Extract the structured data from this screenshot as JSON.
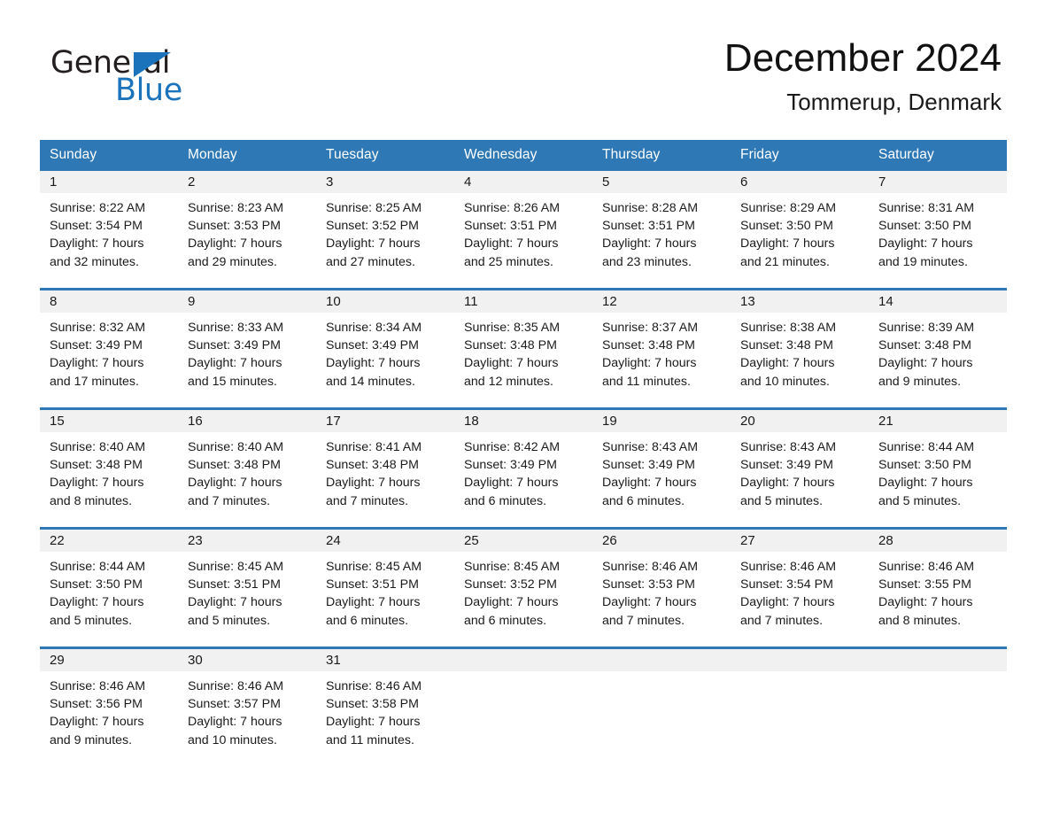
{
  "brand": {
    "name_part1": "General",
    "name_part2": "Blue",
    "triangle_color": "#1b74bb",
    "text_color": "#231f20"
  },
  "header": {
    "title": "December 2024",
    "subtitle": "Tommerup, Denmark"
  },
  "theme": {
    "accent": "#2e79b5",
    "header_text": "#ffffff",
    "daynum_band": "#f1f1f1",
    "body_text": "#1b1b1b"
  },
  "calendar": {
    "weekday_headers": [
      "Sunday",
      "Monday",
      "Tuesday",
      "Wednesday",
      "Thursday",
      "Friday",
      "Saturday"
    ],
    "weeks": [
      [
        {
          "day": "1",
          "details": "Sunrise: 8:22 AM\nSunset: 3:54 PM\nDaylight: 7 hours\nand 32 minutes."
        },
        {
          "day": "2",
          "details": "Sunrise: 8:23 AM\nSunset: 3:53 PM\nDaylight: 7 hours\nand 29 minutes."
        },
        {
          "day": "3",
          "details": "Sunrise: 8:25 AM\nSunset: 3:52 PM\nDaylight: 7 hours\nand 27 minutes."
        },
        {
          "day": "4",
          "details": "Sunrise: 8:26 AM\nSunset: 3:51 PM\nDaylight: 7 hours\nand 25 minutes."
        },
        {
          "day": "5",
          "details": "Sunrise: 8:28 AM\nSunset: 3:51 PM\nDaylight: 7 hours\nand 23 minutes."
        },
        {
          "day": "6",
          "details": "Sunrise: 8:29 AM\nSunset: 3:50 PM\nDaylight: 7 hours\nand 21 minutes."
        },
        {
          "day": "7",
          "details": "Sunrise: 8:31 AM\nSunset: 3:50 PM\nDaylight: 7 hours\nand 19 minutes."
        }
      ],
      [
        {
          "day": "8",
          "details": "Sunrise: 8:32 AM\nSunset: 3:49 PM\nDaylight: 7 hours\nand 17 minutes."
        },
        {
          "day": "9",
          "details": "Sunrise: 8:33 AM\nSunset: 3:49 PM\nDaylight: 7 hours\nand 15 minutes."
        },
        {
          "day": "10",
          "details": "Sunrise: 8:34 AM\nSunset: 3:49 PM\nDaylight: 7 hours\nand 14 minutes."
        },
        {
          "day": "11",
          "details": "Sunrise: 8:35 AM\nSunset: 3:48 PM\nDaylight: 7 hours\nand 12 minutes."
        },
        {
          "day": "12",
          "details": "Sunrise: 8:37 AM\nSunset: 3:48 PM\nDaylight: 7 hours\nand 11 minutes."
        },
        {
          "day": "13",
          "details": "Sunrise: 8:38 AM\nSunset: 3:48 PM\nDaylight: 7 hours\nand 10 minutes."
        },
        {
          "day": "14",
          "details": "Sunrise: 8:39 AM\nSunset: 3:48 PM\nDaylight: 7 hours\nand 9 minutes."
        }
      ],
      [
        {
          "day": "15",
          "details": "Sunrise: 8:40 AM\nSunset: 3:48 PM\nDaylight: 7 hours\nand 8 minutes."
        },
        {
          "day": "16",
          "details": "Sunrise: 8:40 AM\nSunset: 3:48 PM\nDaylight: 7 hours\nand 7 minutes."
        },
        {
          "day": "17",
          "details": "Sunrise: 8:41 AM\nSunset: 3:48 PM\nDaylight: 7 hours\nand 7 minutes."
        },
        {
          "day": "18",
          "details": "Sunrise: 8:42 AM\nSunset: 3:49 PM\nDaylight: 7 hours\nand 6 minutes."
        },
        {
          "day": "19",
          "details": "Sunrise: 8:43 AM\nSunset: 3:49 PM\nDaylight: 7 hours\nand 6 minutes."
        },
        {
          "day": "20",
          "details": "Sunrise: 8:43 AM\nSunset: 3:49 PM\nDaylight: 7 hours\nand 5 minutes."
        },
        {
          "day": "21",
          "details": "Sunrise: 8:44 AM\nSunset: 3:50 PM\nDaylight: 7 hours\nand 5 minutes."
        }
      ],
      [
        {
          "day": "22",
          "details": "Sunrise: 8:44 AM\nSunset: 3:50 PM\nDaylight: 7 hours\nand 5 minutes."
        },
        {
          "day": "23",
          "details": "Sunrise: 8:45 AM\nSunset: 3:51 PM\nDaylight: 7 hours\nand 5 minutes."
        },
        {
          "day": "24",
          "details": "Sunrise: 8:45 AM\nSunset: 3:51 PM\nDaylight: 7 hours\nand 6 minutes."
        },
        {
          "day": "25",
          "details": "Sunrise: 8:45 AM\nSunset: 3:52 PM\nDaylight: 7 hours\nand 6 minutes."
        },
        {
          "day": "26",
          "details": "Sunrise: 8:46 AM\nSunset: 3:53 PM\nDaylight: 7 hours\nand 7 minutes."
        },
        {
          "day": "27",
          "details": "Sunrise: 8:46 AM\nSunset: 3:54 PM\nDaylight: 7 hours\nand 7 minutes."
        },
        {
          "day": "28",
          "details": "Sunrise: 8:46 AM\nSunset: 3:55 PM\nDaylight: 7 hours\nand 8 minutes."
        }
      ],
      [
        {
          "day": "29",
          "details": "Sunrise: 8:46 AM\nSunset: 3:56 PM\nDaylight: 7 hours\nand 9 minutes."
        },
        {
          "day": "30",
          "details": "Sunrise: 8:46 AM\nSunset: 3:57 PM\nDaylight: 7 hours\nand 10 minutes."
        },
        {
          "day": "31",
          "details": "Sunrise: 8:46 AM\nSunset: 3:58 PM\nDaylight: 7 hours\nand 11 minutes."
        },
        {
          "day": "",
          "details": ""
        },
        {
          "day": "",
          "details": ""
        },
        {
          "day": "",
          "details": ""
        },
        {
          "day": "",
          "details": ""
        }
      ]
    ]
  }
}
